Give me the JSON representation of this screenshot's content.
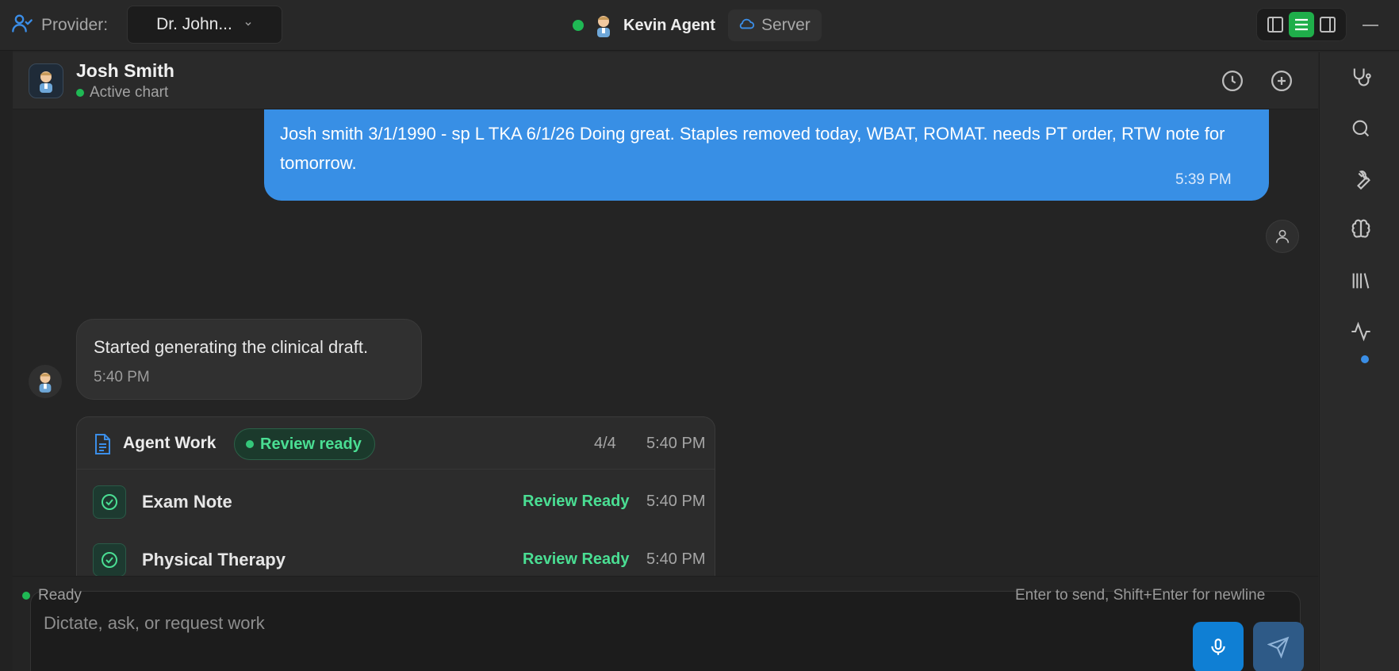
{
  "topbar": {
    "provider_label": "Provider:",
    "provider_value": "Dr. John...",
    "agent_name": "Kevin Agent",
    "server_label": "Server"
  },
  "patient": {
    "name": "Josh Smith",
    "status": "Active chart"
  },
  "messages": {
    "user": {
      "text": "Josh smith 3/1/1990 - sp L TKA 6/1/26 Doing great. Staples removed today, WBAT, ROMAT. needs PT order, RTW note for tomorrow.",
      "time": "5:39 PM"
    },
    "bot": {
      "text": "Started generating the clinical draft.",
      "time": "5:40 PM"
    }
  },
  "agent_work": {
    "title": "Agent Work",
    "badge": "Review ready",
    "count": "4/4",
    "time": "5:40 PM",
    "items": [
      {
        "label": "Exam Note",
        "status": "Review Ready",
        "time": "5:40 PM"
      },
      {
        "label": "Physical Therapy",
        "status": "Review Ready",
        "time": "5:40 PM"
      }
    ]
  },
  "composer": {
    "placeholder": "Dictate, ask, or request work",
    "status": "Ready",
    "hint": "Enter to send, Shift+Enter for newline"
  },
  "rail": {
    "icons": [
      "stethoscope-icon",
      "search-icon",
      "wrench-icon",
      "brain-icon",
      "library-icon",
      "activity-icon"
    ]
  },
  "colors": {
    "accent_blue": "#388fe5",
    "status_green": "#1fb854",
    "review_green": "#4ade93",
    "toggle_active": "#1fae4a"
  }
}
